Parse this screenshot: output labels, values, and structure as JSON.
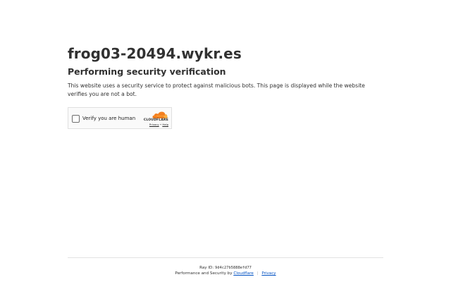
{
  "main": {
    "host": "frog03-20494.wykr.es",
    "subtitle": "Performing security verification",
    "description": "This website uses a security service to protect against malicious bots. This page is displayed while the website verifies you are not a bot."
  },
  "widget": {
    "checkbox_label": "Verify you are human",
    "checked": false,
    "brand": "CLOUDFLARE",
    "privacy_link": "Privacy",
    "help_link": "Help",
    "link_separator": "•",
    "logo_icon": "cloudflare-logo-icon",
    "brand_color": "#f38020"
  },
  "footer": {
    "ray_label": "Ray ID:",
    "ray_id": "9d4c27b5888efd77",
    "perf_text": "Performance and Security by",
    "cloudflare_link": "Cloudflare",
    "separator": "|",
    "privacy_link": "Privacy",
    "link_color": "#0051c3"
  }
}
